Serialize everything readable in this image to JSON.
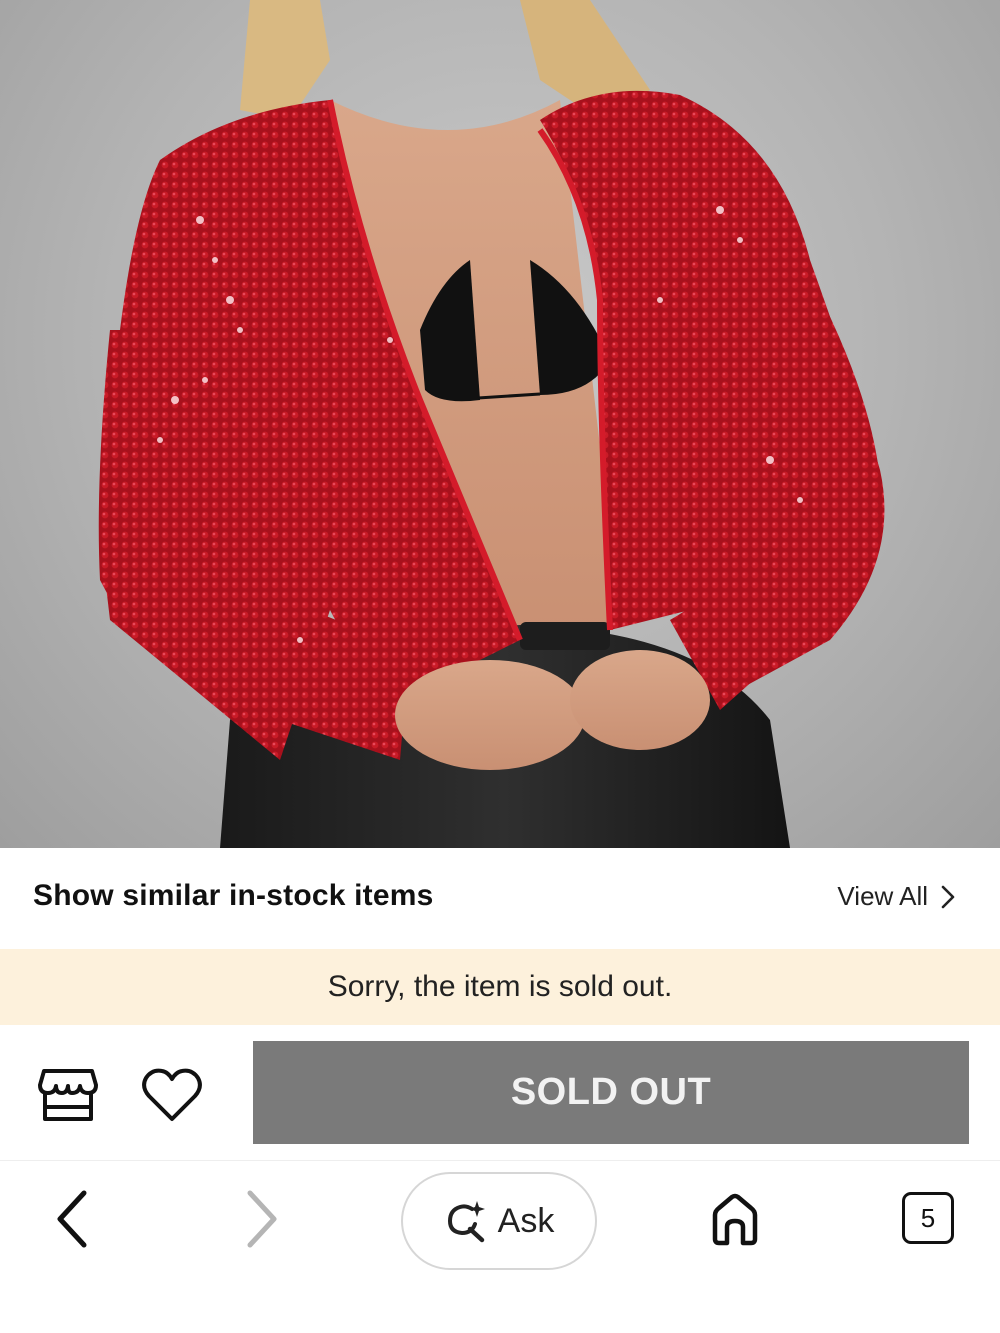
{
  "product": {
    "image_alt": "Red sequin open-front cropped jacket"
  },
  "similar": {
    "title": "Show similar in-stock items",
    "view_all_label": "View All"
  },
  "notice": {
    "text": "Sorry, the item is sold out."
  },
  "actions": {
    "sold_out_label": "SOLD OUT",
    "store_icon": "store-icon",
    "wishlist_icon": "heart-icon"
  },
  "browser_nav": {
    "back_icon": "chevron-left-icon",
    "forward_icon": "chevron-right-icon",
    "ask_label": "Ask",
    "ask_icon": "sparkle-search-icon",
    "home_icon": "home-icon",
    "tab_count": "5"
  },
  "colors": {
    "notice_bg": "#fdf1dc",
    "sold_out_bg": "#7a7a7a",
    "jacket_red": "#b0121e"
  }
}
